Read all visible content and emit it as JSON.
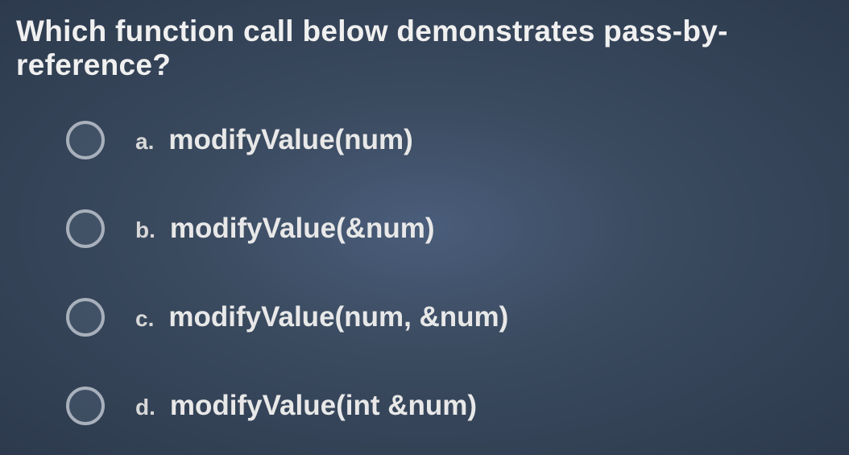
{
  "question": {
    "text": "Which function call below demonstrates pass-by-reference?"
  },
  "options": [
    {
      "letter": "a.",
      "text": "modifyValue(num)"
    },
    {
      "letter": "b.",
      "text": "modifyValue(&num)"
    },
    {
      "letter": "c.",
      "text": "modifyValue(num, &num)"
    },
    {
      "letter": "d.",
      "text": "modifyValue(int &num)"
    }
  ]
}
